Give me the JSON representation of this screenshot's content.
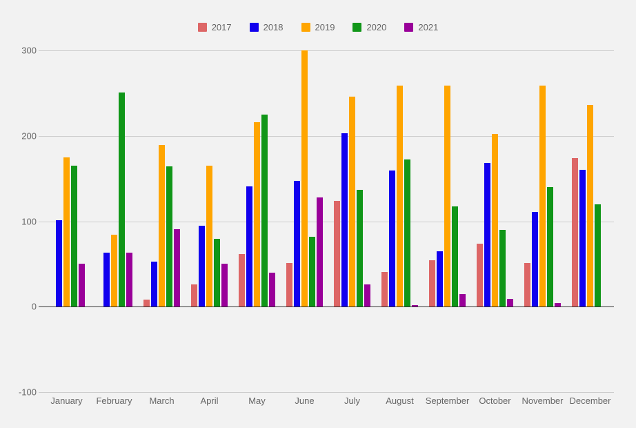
{
  "chart_data": {
    "type": "bar",
    "title": "",
    "subtitle": "",
    "xlabel": "",
    "ylabel": "",
    "categories": [
      "January",
      "February",
      "March",
      "April",
      "May",
      "June",
      "July",
      "August",
      "September",
      "October",
      "November",
      "December"
    ],
    "series": [
      {
        "name": "2017",
        "color": "#dd6666",
        "values": [
          0,
          0,
          8,
          26,
          62,
          51,
          124,
          41,
          54,
          74,
          51,
          174
        ]
      },
      {
        "name": "2018",
        "color": "#1100ee",
        "values": [
          101,
          63,
          53,
          95,
          141,
          147,
          203,
          159,
          65,
          168,
          111,
          160
        ]
      },
      {
        "name": "2019",
        "color": "#ffa500",
        "values": [
          175,
          84,
          189,
          165,
          216,
          300,
          246,
          259,
          259,
          202,
          259,
          236
        ]
      },
      {
        "name": "2020",
        "color": "#109618",
        "values": [
          165,
          251,
          164,
          79,
          225,
          82,
          137,
          172,
          117,
          90,
          140,
          120
        ]
      },
      {
        "name": "2021",
        "color": "#990099",
        "values": [
          50,
          63,
          91,
          50,
          40,
          128,
          26,
          2,
          15,
          9,
          4,
          0
        ]
      }
    ],
    "yticks": [
      300,
      200,
      100,
      0,
      -100
    ],
    "ytick_labels": [
      "300",
      "200",
      "100",
      "0",
      "-100"
    ],
    "ylim": [
      -100,
      300
    ],
    "grid": true,
    "legend_position": "top",
    "background_color": "#f2f2f2",
    "gridline_color": "#cccccc",
    "axis_color": "#333333",
    "text_color": "#666666"
  }
}
